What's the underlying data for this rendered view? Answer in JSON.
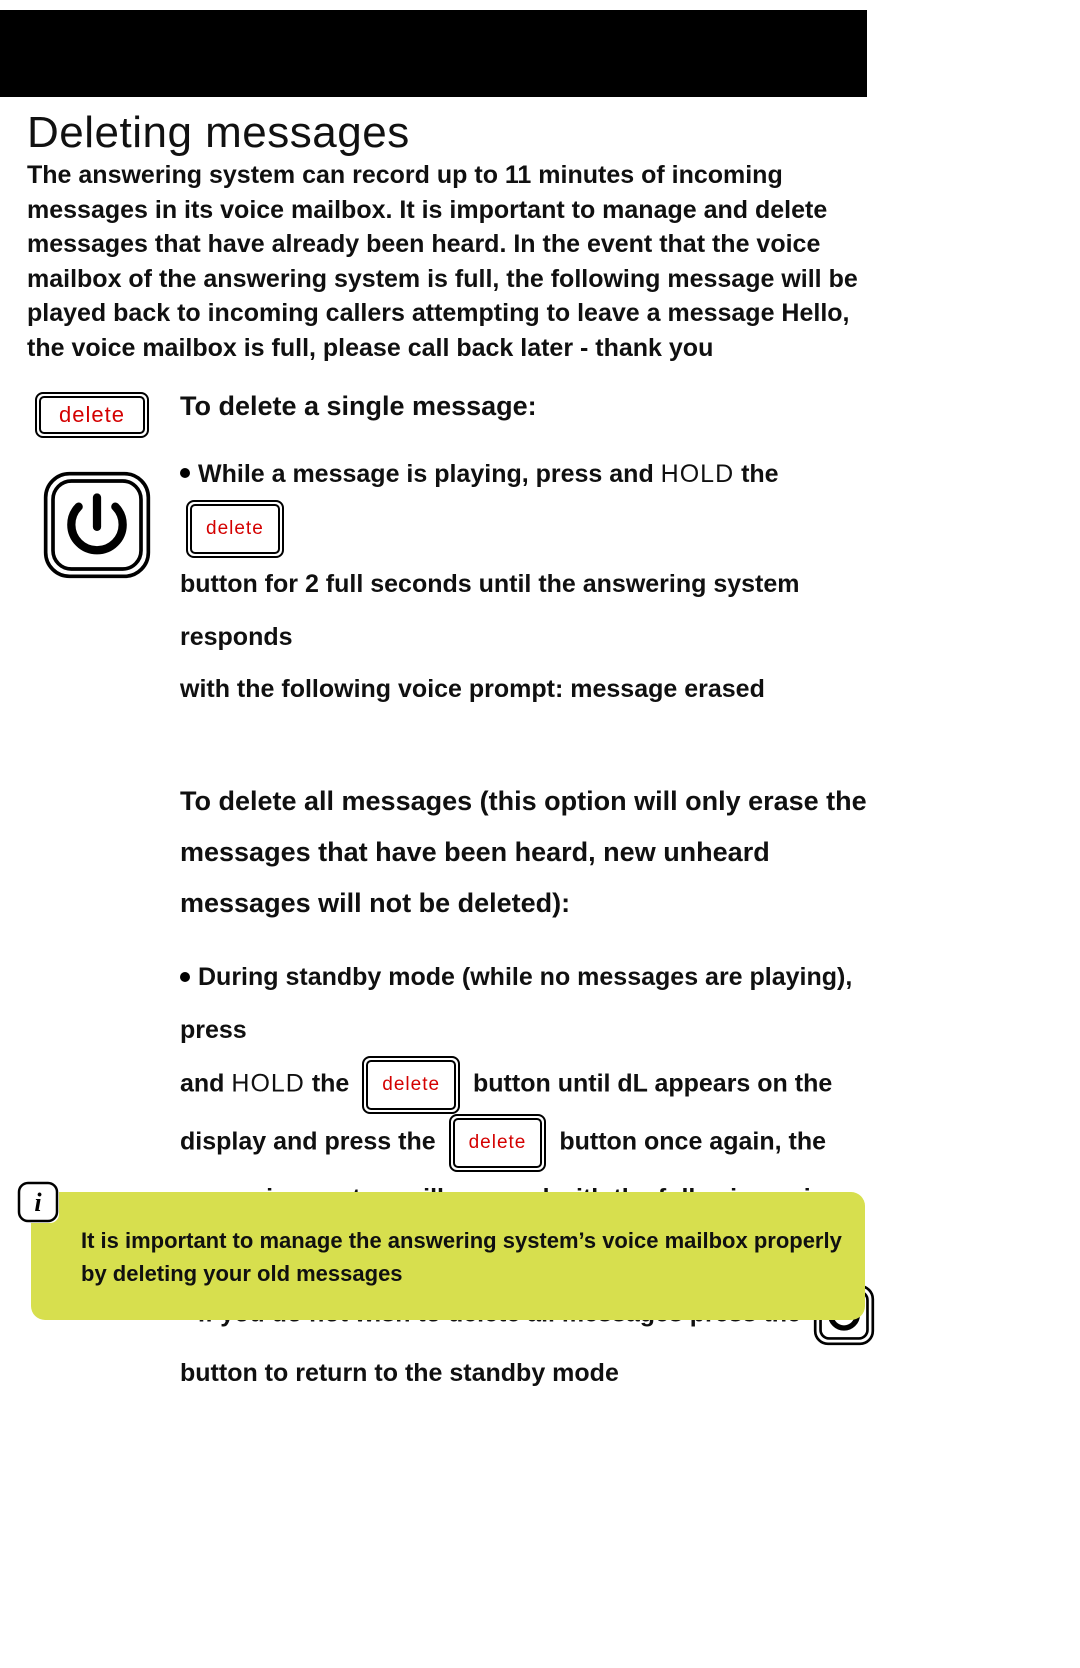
{
  "page": {
    "title": "Deleting messages",
    "intro": "The answering system can record up to 11 minutes of incoming messages in its voice mailbox.  It is important to manage and delete messages that have already been heard.  In the event that the voice mailbox of the answering system is full, the following message will be played back to incoming callers attempting to leave a message Hello, the voice mailbox is full, please call back later - thank you"
  },
  "buttons": {
    "delete_label": "delete",
    "power_name": "power-button"
  },
  "single": {
    "heading": "To delete a single message:",
    "line1a": "While a message is playing, press and ",
    "hold": "HOLD",
    "line1b": " the ",
    "line2": "button for 2 full seconds until the answering system responds",
    "line3": "with the following voice prompt: message erased"
  },
  "all": {
    "heading": "To delete all messages (this option will only erase the messages that have been heard, new unheard messages will not be deleted):",
    "p1_a": "During standby mode (while no messages are playing), press",
    "p1_b": "and ",
    "hold": "HOLD",
    "p1_c": " the ",
    "p1_d": " button until dL appears on the ",
    "p1_d_prefix": " button until dL",
    "p1_d_suffix": "appears on the",
    "p1_e": "display and press the",
    "p1_f": " button once again, the",
    "p1_g": "answering system will respond with the following voice prompt: all messages erased",
    "p2_a": "If you do not wish to delete all messages press the",
    "p2_b": "button to return to the standby mode"
  },
  "callout": {
    "text": "It is important to manage the answering system’s voice mailbox properly by deleting your old messages"
  }
}
